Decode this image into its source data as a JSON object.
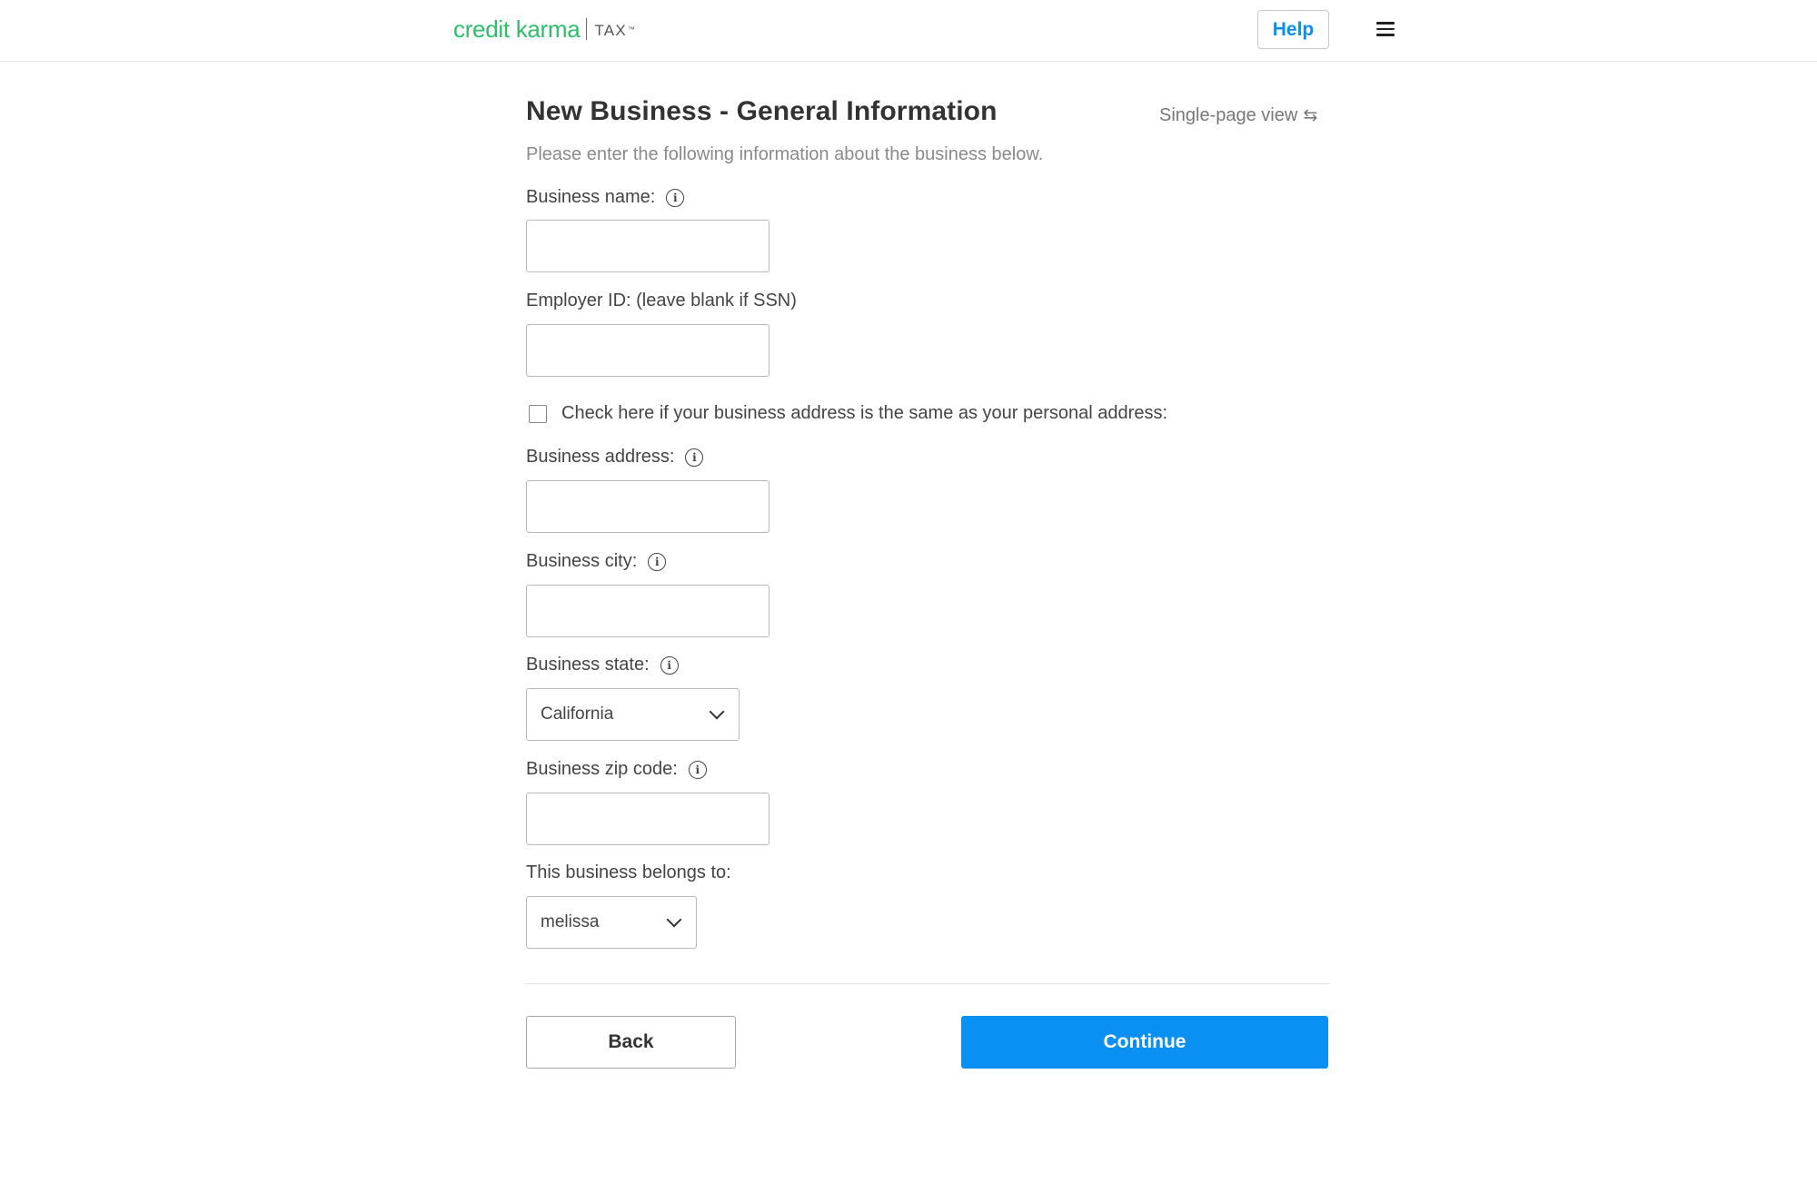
{
  "header": {
    "brand": "credit karma",
    "product": "TAX",
    "help_label": "Help",
    "menu_icon": "hamburger-menu-icon"
  },
  "page": {
    "title": "New Business - General Information",
    "single_page_view": "Single-page view",
    "single_page_icon": "swap-arrows-icon",
    "subtitle": "Please enter the following information about the business below."
  },
  "form": {
    "business_name": {
      "label": "Business name:",
      "value": "",
      "info_icon": true
    },
    "employer_id": {
      "label": "Employer ID: (leave blank if SSN)",
      "value": ""
    },
    "same_address": {
      "label": "Check here if your business address is the same as your personal address:",
      "checked": false
    },
    "business_address": {
      "label": "Business address:",
      "value": "",
      "info_icon": true
    },
    "business_city": {
      "label": "Business city:",
      "value": "",
      "info_icon": true
    },
    "business_state": {
      "label": "Business state:",
      "selected": "California",
      "info_icon": true
    },
    "business_zip": {
      "label": "Business zip code:",
      "value": "",
      "info_icon": true
    },
    "belongs_to": {
      "label": "This business belongs to:",
      "selected": "melissa"
    }
  },
  "actions": {
    "back_label": "Back",
    "continue_label": "Continue"
  },
  "colors": {
    "brand_green": "#2ebd6b",
    "accent_blue": "#0a8ff2"
  }
}
